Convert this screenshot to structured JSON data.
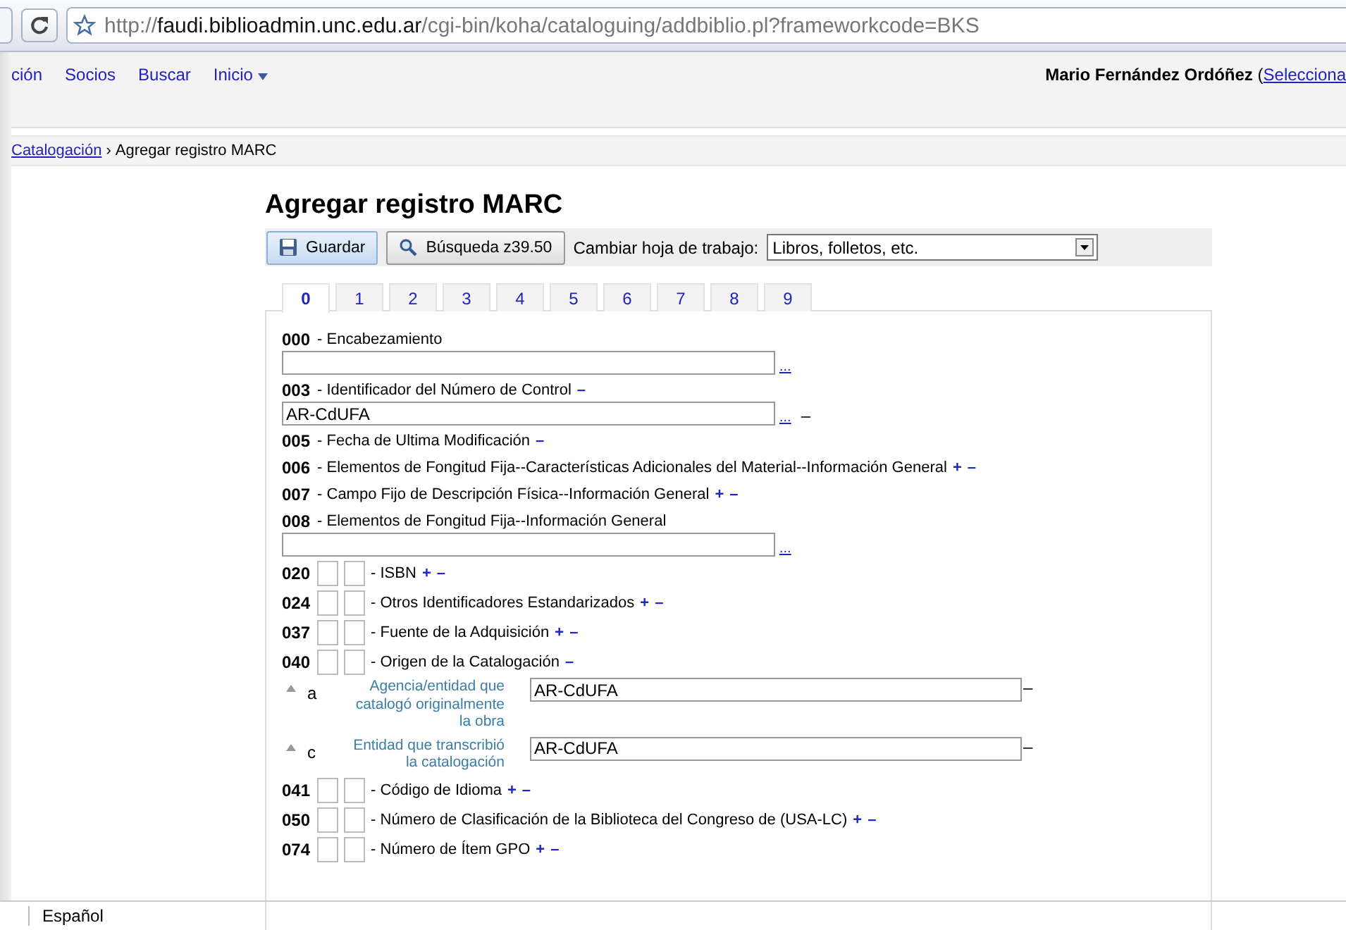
{
  "browser": {
    "url": {
      "scheme": "http://",
      "host": "faudi.biblioadmin.unc.edu.ar",
      "path": "/cgi-bin/koha/cataloguing/addbiblio.pl?frameworkcode=BKS"
    }
  },
  "nav": {
    "items": [
      {
        "label": "ción",
        "menu": false
      },
      {
        "label": "Socios",
        "menu": false
      },
      {
        "label": "Buscar",
        "menu": false
      },
      {
        "label": "Inicio",
        "menu": true
      }
    ],
    "user": {
      "name": "Mario Fernández Ordóñez",
      "paren": "(",
      "link": "Selecciona"
    }
  },
  "breadcrumb": {
    "link": "Catalogación",
    "separator": "›",
    "current": "Agregar registro MARC"
  },
  "title": "Agregar registro MARC",
  "toolbar": {
    "save": "Guardar",
    "search": "Búsqueda z39.50",
    "framework_label": "Cambiar hoja de trabajo:",
    "framework_value": "Libros, folletos, etc."
  },
  "tabs": [
    {
      "label": "0",
      "selected": true
    },
    {
      "label": "1",
      "selected": false
    },
    {
      "label": "2",
      "selected": false
    },
    {
      "label": "3",
      "selected": false
    },
    {
      "label": "4",
      "selected": false
    },
    {
      "label": "5",
      "selected": false
    },
    {
      "label": "6",
      "selected": false
    },
    {
      "label": "7",
      "selected": false
    },
    {
      "label": "8",
      "selected": false
    },
    {
      "label": "9",
      "selected": false
    }
  ],
  "fields": [
    {
      "tag": "000",
      "kind": "control",
      "label": "- Encabezamiento",
      "input": {
        "link": "..."
      }
    },
    {
      "tag": "003",
      "kind": "control",
      "label": "- Identificador del Número de Control",
      "actions": [
        "–"
      ],
      "input": {
        "value": "AR-CdUFA",
        "link": "...",
        "actions": [
          "–"
        ]
      }
    },
    {
      "tag": "005",
      "kind": "header",
      "label": "- Fecha de Ultima Modificación",
      "actions": [
        "–"
      ]
    },
    {
      "tag": "006",
      "kind": "header",
      "label": "- Elementos de Fongitud Fija--Características Adicionales del Material--Información General",
      "actions": [
        "+",
        "–"
      ]
    },
    {
      "tag": "007",
      "kind": "header",
      "label": "- Campo Fijo de Descripción Física--Información General",
      "actions": [
        "+",
        "–"
      ]
    },
    {
      "tag": "008",
      "kind": "control",
      "label": "- Elementos de Fongitud Fija--Información General",
      "input": {
        "link": "..."
      }
    },
    {
      "tag": "020",
      "kind": "indicators",
      "label": "- ISBN",
      "actions": [
        "+",
        "–"
      ]
    },
    {
      "tag": "024",
      "kind": "indicators",
      "label": "- Otros Identificadores Estandarizados",
      "actions": [
        "+",
        "–"
      ]
    },
    {
      "tag": "037",
      "kind": "indicators",
      "label": "- Fuente de la Adquisición",
      "actions": [
        "+",
        "–"
      ]
    },
    {
      "tag": "040",
      "kind": "indicators",
      "label": "- Origen de la Catalogación",
      "actions": [
        "–"
      ],
      "subfields": [
        {
          "code": "a",
          "label": "Agencia/entidad que catalogó originalmente la obra",
          "value": "AR-CdUFA",
          "actions": [
            "–"
          ]
        },
        {
          "code": "c",
          "label": "Entidad que transcribió la catalogación",
          "value": "AR-CdUFA",
          "actions": [
            "–"
          ]
        }
      ]
    },
    {
      "tag": "041",
      "kind": "indicators",
      "label": "- Código de Idioma",
      "actions": [
        "+",
        "–"
      ]
    },
    {
      "tag": "050",
      "kind": "indicators",
      "label": "- Número de Clasificación de la Biblioteca del Congreso de (USA-LC)",
      "actions": [
        "+",
        "–"
      ]
    },
    {
      "tag": "074",
      "kind": "indicators",
      "label": "- Número de Ítem GPO",
      "actions": [
        "+",
        "–"
      ]
    }
  ],
  "status_bar": {
    "language": "Español"
  }
}
